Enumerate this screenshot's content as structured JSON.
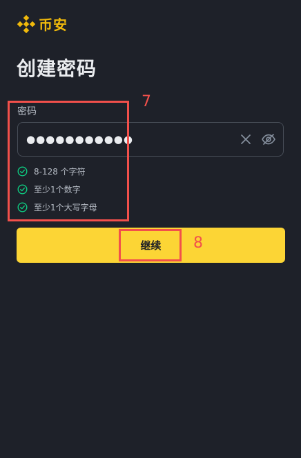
{
  "brand": {
    "name": "币安",
    "icon": "binance-logo-icon",
    "color": "#f0b90b"
  },
  "page": {
    "title": "创建密码"
  },
  "password_field": {
    "label": "密码",
    "value": "●●●●●●●●●●●",
    "clear_icon": "close-icon",
    "visibility_icon": "eye-off-icon"
  },
  "requirements": [
    {
      "text": "8-128 个字符",
      "met": true
    },
    {
      "text": "至少1个数字",
      "met": true
    },
    {
      "text": "至少1个大写字母",
      "met": true
    }
  ],
  "continue_button": {
    "label": "继续",
    "color": "#fcd535"
  },
  "annotations": [
    {
      "number": "7",
      "color": "#f2504b"
    },
    {
      "number": "8",
      "color": "#f2504b"
    }
  ],
  "colors": {
    "background": "#1e2129",
    "check": "#0ecb81",
    "text_secondary": "#b7bdc6"
  }
}
